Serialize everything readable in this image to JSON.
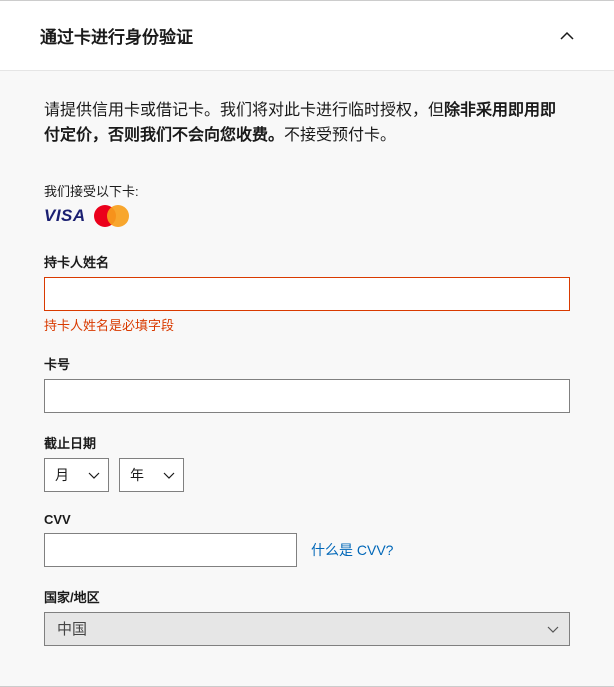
{
  "header": {
    "title": "通过卡进行身份验证"
  },
  "intro": {
    "part1": "请提供信用卡或借记卡。我们将对此卡进行临时授权，但",
    "bold": "除非采用即用即付定价，否则我们不会向您收费。",
    "part2": "不接受预付卡。"
  },
  "accept_label": "我们接受以下卡:",
  "fields": {
    "cardholder": {
      "label": "持卡人姓名",
      "value": "",
      "error": "持卡人姓名是必填字段"
    },
    "cardnumber": {
      "label": "卡号",
      "value": ""
    },
    "expiry": {
      "label": "截止日期",
      "month": "月",
      "year": "年"
    },
    "cvv": {
      "label": "CVV",
      "value": "",
      "help": "什么是 CVV?"
    },
    "country": {
      "label": "国家/地区",
      "value": "中国"
    }
  }
}
